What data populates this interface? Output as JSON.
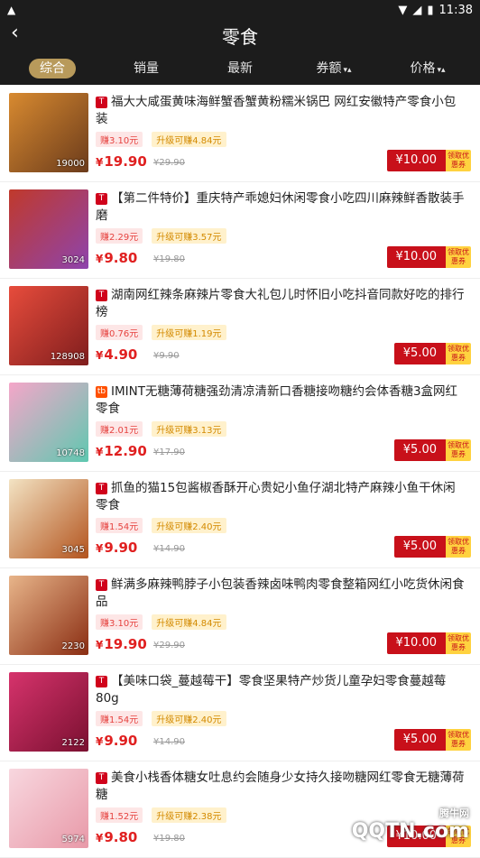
{
  "status": {
    "time": "11:38"
  },
  "header": {
    "title": "零食"
  },
  "sort_tabs": [
    {
      "label": "综合",
      "active": true
    },
    {
      "label": "销量"
    },
    {
      "label": "最新"
    },
    {
      "label": "券额",
      "caret": "▾▴"
    },
    {
      "label": "价格",
      "caret": "▾▴"
    }
  ],
  "products": [
    {
      "platform": "T",
      "title": "福大大咸蛋黄味海鲜蟹香蟹黄粉糯米锅巴 网红安徽特产零食小包装",
      "earn": "赚3.10元",
      "upgrade": "升级可赚4.84元",
      "price": "19.90",
      "original_price": "¥29.90",
      "coupon": "¥10.00",
      "coupon_get": "领取优惠券",
      "sales": "19000",
      "thumb_colors": [
        "#d88a30",
        "#6b3b1b"
      ]
    },
    {
      "platform": "T",
      "title": "【第二件特价】重庆特产乖媳妇休闲零食小吃四川麻辣鲜香散装手磨",
      "earn": "赚2.29元",
      "upgrade": "升级可赚3.57元",
      "price": "9.80",
      "original_price": "¥19.80",
      "coupon": "¥10.00",
      "coupon_get": "领取优惠券",
      "sales": "3024",
      "thumb_colors": [
        "#c0392b",
        "#8e44ad"
      ]
    },
    {
      "platform": "T",
      "title": "湖南网红辣条麻辣片零食大礼包儿时怀旧小吃抖音同款好吃的排行榜",
      "earn": "赚0.76元",
      "upgrade": "升级可赚1.19元",
      "price": "4.90",
      "original_price": "¥9.90",
      "coupon": "¥5.00",
      "coupon_get": "领取优惠券",
      "sales": "128908",
      "thumb_colors": [
        "#e74c3c",
        "#7f1d1d"
      ]
    },
    {
      "platform": "tb",
      "title": "IMINT无糖薄荷糖强劲清凉清新口香糖接吻糖约会体香糖3盒网红零食",
      "earn": "赚2.01元",
      "upgrade": "升级可赚3.13元",
      "price": "12.90",
      "original_price": "¥17.90",
      "coupon": "¥5.00",
      "coupon_get": "领取优惠券",
      "sales": "10748",
      "thumb_colors": [
        "#f5a6c9",
        "#5ec8b0"
      ]
    },
    {
      "platform": "T",
      "title": "抓鱼的猫15包酱椒香酥开心贵妃小鱼仔湖北特产麻辣小鱼干休闲零食",
      "earn": "赚1.54元",
      "upgrade": "升级可赚2.40元",
      "price": "9.90",
      "original_price": "¥14.90",
      "coupon": "¥5.00",
      "coupon_get": "领取优惠券",
      "sales": "3045",
      "thumb_colors": [
        "#f3e3c3",
        "#b3541e"
      ]
    },
    {
      "platform": "T",
      "title": "鲜满多麻辣鸭脖子小包装香辣卤味鸭肉零食整箱网红小吃货休闲食品",
      "earn": "赚3.10元",
      "upgrade": "升级可赚4.84元",
      "price": "19.90",
      "original_price": "¥29.90",
      "coupon": "¥10.00",
      "coupon_get": "领取优惠券",
      "sales": "2230",
      "thumb_colors": [
        "#e8b58a",
        "#8a2d12"
      ]
    },
    {
      "platform": "T",
      "title": "【美味口袋_蔓越莓干】零食坚果特产炒货儿童孕妇零食蔓越莓80g",
      "earn": "赚1.54元",
      "upgrade": "升级可赚2.40元",
      "price": "9.90",
      "original_price": "¥14.90",
      "coupon": "¥5.00",
      "coupon_get": "领取优惠券",
      "sales": "2122",
      "thumb_colors": [
        "#d6336c",
        "#7a1030"
      ]
    },
    {
      "platform": "T",
      "title": "美食小栈香体糖女吐息约会随身少女持久接吻糖网红零食无糖薄荷糖",
      "earn": "赚1.52元",
      "upgrade": "升级可赚2.38元",
      "price": "9.80",
      "original_price": "¥19.80",
      "coupon": "¥10.00",
      "coupon_get": "领取优惠券",
      "sales": "5974",
      "thumb_colors": [
        "#f8d7df",
        "#e899a8"
      ]
    }
  ],
  "watermark": {
    "main": "QQTN.com",
    "sub": "腾牛网"
  }
}
